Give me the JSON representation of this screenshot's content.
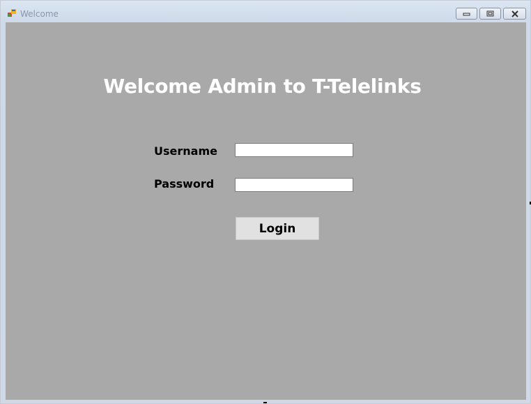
{
  "window": {
    "title": "Welcome",
    "icon": "app-form-icon",
    "controls": {
      "minimize_icon": "minimize-icon",
      "maximize_icon": "maximize-icon",
      "close_icon": "close-icon"
    }
  },
  "form": {
    "heading": "Welcome Admin to T-Telelinks",
    "username_label": "Username",
    "username_value": "",
    "password_label": "Password",
    "password_value": "",
    "login_label": "Login"
  },
  "colors": {
    "client_background": "#a9a9a9",
    "heading_text": "#ffffff",
    "button_background": "#e1e1e1"
  }
}
